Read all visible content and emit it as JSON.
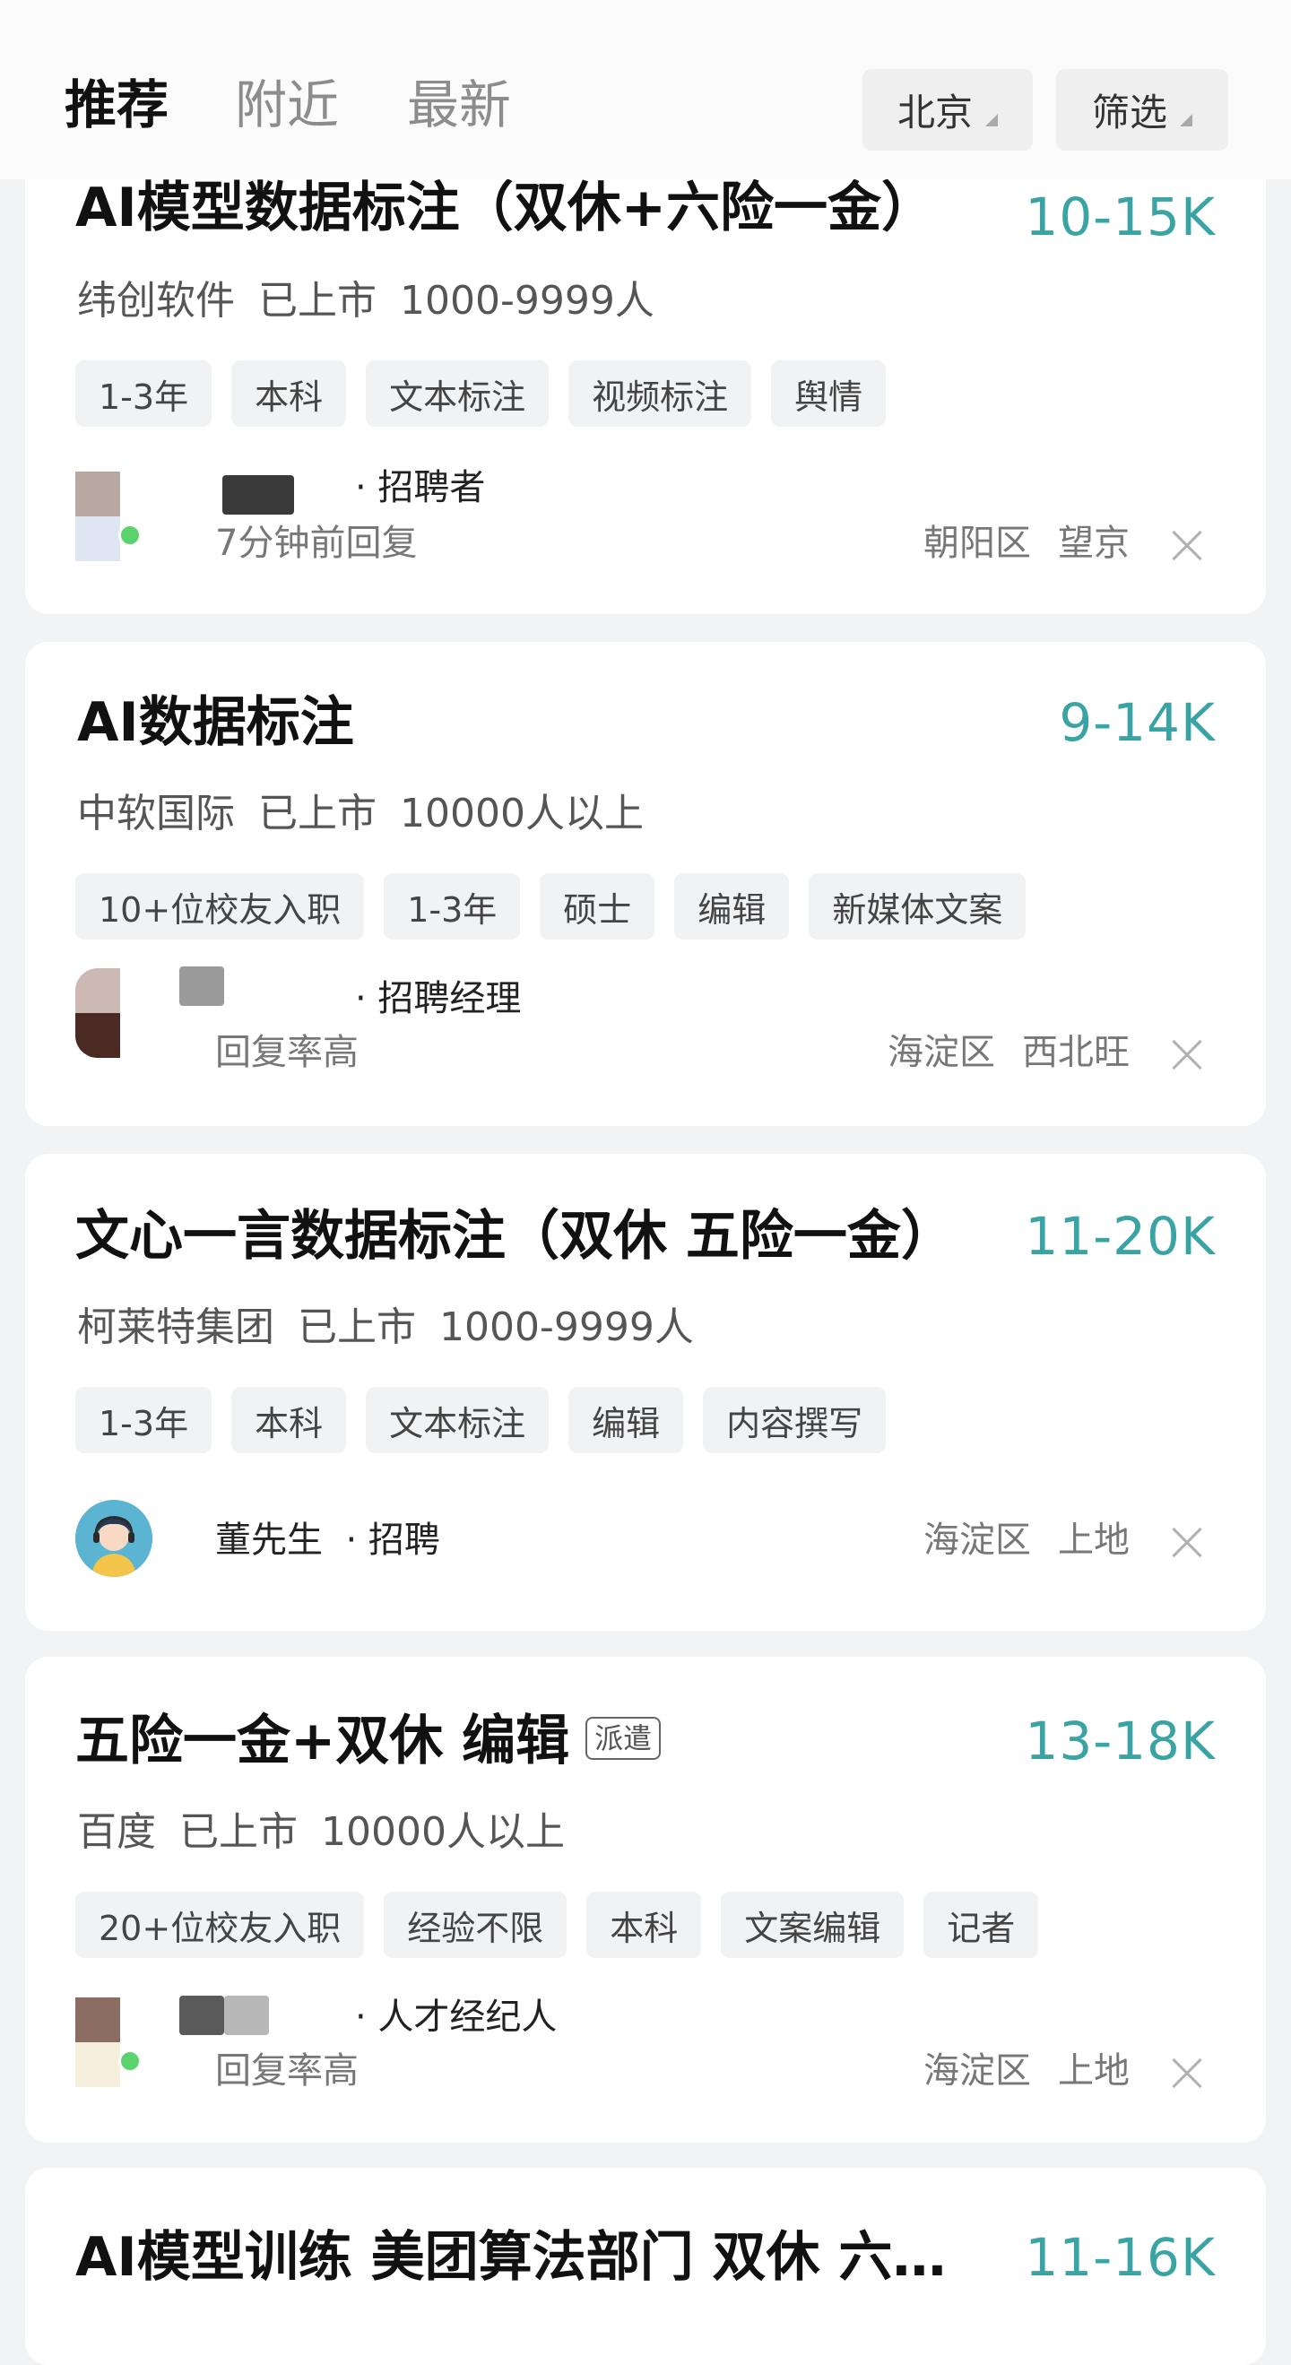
{
  "header": {
    "tabs": [
      {
        "label": "推荐",
        "active": true
      },
      {
        "label": "附近",
        "active": false
      },
      {
        "label": "最新",
        "active": false
      }
    ],
    "city_button": "北京",
    "filter_button": "筛选"
  },
  "colors": {
    "salary": "#3aa3a4",
    "online_dot": "#5bd36c"
  },
  "jobs": [
    {
      "title": "AI模型数据标注（双休+六险一金）",
      "salary": "10-15K",
      "company": "纬创软件",
      "status": "已上市",
      "size": "1000-9999人",
      "tags": [
        "1-3年",
        "本科",
        "文本标注",
        "视频标注",
        "舆情"
      ],
      "recruiter_role": "· 招聘者",
      "reply": "7分钟前回复",
      "district": "朝阳区",
      "area": "望京"
    },
    {
      "title": "AI数据标注",
      "salary": "9-14K",
      "company": "中软国际",
      "status": "已上市",
      "size": "10000人以上",
      "tags": [
        "10+位校友入职",
        "1-3年",
        "硕士",
        "编辑",
        "新媒体文案"
      ],
      "recruiter_role": "· 招聘经理",
      "reply": "回复率高",
      "district": "海淀区",
      "area": "西北旺"
    },
    {
      "title": "文心一言数据标注（双休 五险一金）",
      "salary": "11-20K",
      "company": "柯莱特集团",
      "status": "已上市",
      "size": "1000-9999人",
      "tags": [
        "1-3年",
        "本科",
        "文本标注",
        "编辑",
        "内容撰写"
      ],
      "recruiter_name": "董先生",
      "recruiter_role": "· 招聘",
      "district": "海淀区",
      "area": "上地"
    },
    {
      "title": "五险一金+双休 编辑",
      "badge": "派遣",
      "salary": "13-18K",
      "company": "百度",
      "status": "已上市",
      "size": "10000人以上",
      "tags": [
        "20+位校友入职",
        "经验不限",
        "本科",
        "文案编辑",
        "记者"
      ],
      "recruiter_role": "· 人才经纪人",
      "reply": "回复率高",
      "district": "海淀区",
      "area": "上地"
    },
    {
      "title": "AI模型训练 美团算法部门 双休 六…",
      "salary": "11-16K"
    }
  ]
}
